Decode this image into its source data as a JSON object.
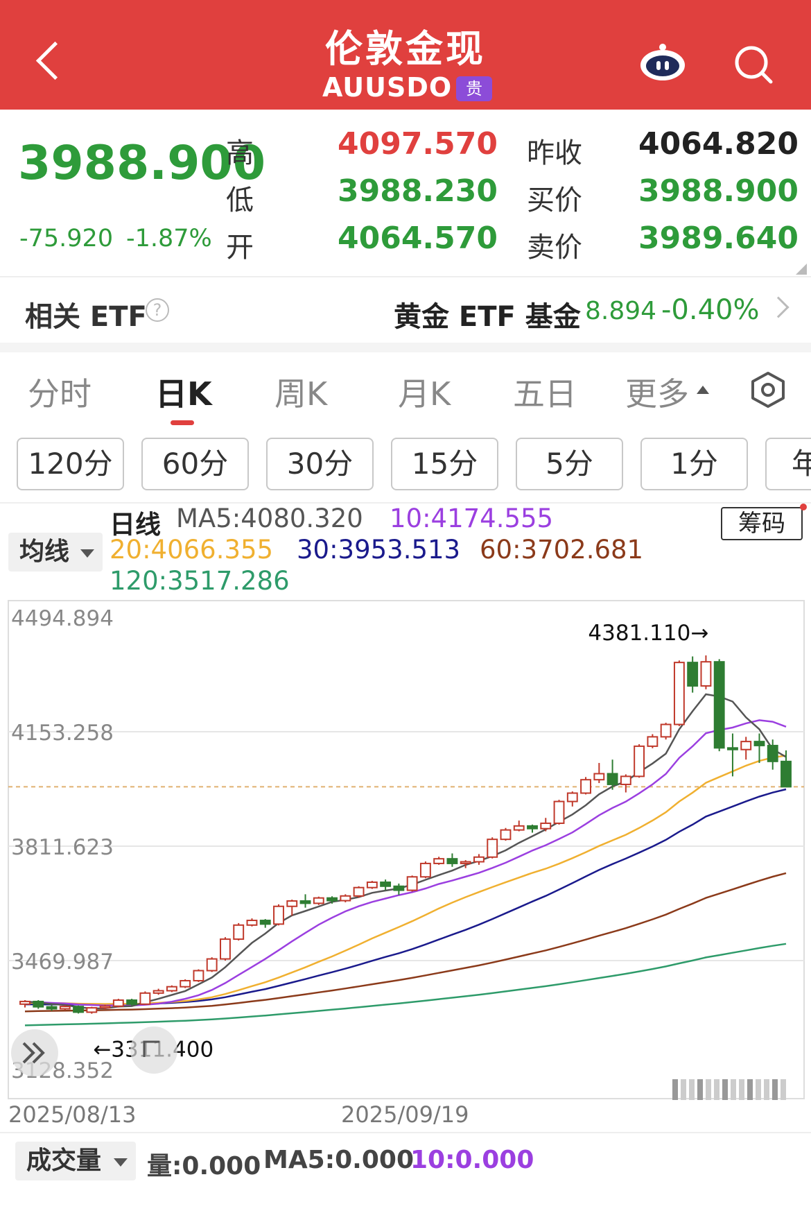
{
  "header": {
    "title": "伦敦金现",
    "symbol": "AUUSDO",
    "badge": "贵",
    "bg_color": "#e0403e"
  },
  "quote": {
    "price": "3988.900",
    "change": "-75.920",
    "change_pct": "-1.87%",
    "high_label": "高",
    "high": "4097.570",
    "low_label": "低",
    "low": "3988.230",
    "open_label": "开",
    "open": "4064.570",
    "prev_close_label": "昨收",
    "prev_close": "4064.820",
    "bid_label": "买价",
    "bid": "3988.900",
    "ask_label": "卖价",
    "ask": "3989.640"
  },
  "etf": {
    "label": "相关 ETF",
    "help_icon": "?",
    "fund_name": "黄金 ETF 基金",
    "fund_price": "8.894",
    "fund_pct": "-0.40%"
  },
  "tabs": [
    {
      "label": "分时",
      "active": false
    },
    {
      "label": "日K",
      "active": true
    },
    {
      "label": "周K",
      "active": false
    },
    {
      "label": "月K",
      "active": false
    },
    {
      "label": "五日",
      "active": false
    },
    {
      "label": "更多",
      "active": false
    }
  ],
  "intervals": [
    "120分",
    "60分",
    "30分",
    "15分",
    "5分",
    "1分",
    "年"
  ],
  "ma_legend": {
    "dropdown": "均线",
    "series_label": "日线",
    "ma5": "MA5:4080.320",
    "ma10": "10:4174.555",
    "ma20": "20:4066.355",
    "ma30": "30:3953.513",
    "ma60": "60:3702.681",
    "ma120": "120:3517.286",
    "chouma": "筹码"
  },
  "chart_data": {
    "type": "candlestick",
    "y_ticks": [
      "4494.894",
      "4153.258",
      "3811.623",
      "3469.987",
      "3128.352"
    ],
    "ylim": [
      3128.352,
      4494.894
    ],
    "max_annotation": "4381.110→",
    "min_annotation": "←3311.400",
    "x_labels": [
      "2025/08/13",
      "2025/09/19"
    ],
    "current_price": 3988.9,
    "colors": {
      "up": "#c0392b",
      "down": "#2e7d32",
      "ma5": "#555555",
      "ma10": "#9b3fe0",
      "ma20": "#f0b030",
      "ma30": "#1a1a8c",
      "ma60": "#8b3a1a",
      "ma120": "#2e9b6a"
    },
    "candles": [
      [
        3340,
        3348,
        3330,
        3352
      ],
      [
        3348,
        3332,
        3326,
        3352
      ],
      [
        3332,
        3326,
        3320,
        3338
      ],
      [
        3326,
        3333,
        3322,
        3337
      ],
      [
        3333,
        3316,
        3312,
        3336
      ],
      [
        3316,
        3329,
        3311.4,
        3332
      ],
      [
        3329,
        3334,
        3325,
        3338
      ],
      [
        3334,
        3352,
        3330,
        3356
      ],
      [
        3352,
        3340,
        3336,
        3356
      ],
      [
        3340,
        3373,
        3338,
        3378
      ],
      [
        3373,
        3380,
        3368,
        3386
      ],
      [
        3380,
        3392,
        3376,
        3396
      ],
      [
        3392,
        3410,
        3388,
        3414
      ],
      [
        3410,
        3440,
        3406,
        3444
      ],
      [
        3440,
        3475,
        3436,
        3480
      ],
      [
        3475,
        3534,
        3470,
        3540
      ],
      [
        3534,
        3576,
        3530,
        3582
      ],
      [
        3576,
        3590,
        3572,
        3596
      ],
      [
        3590,
        3579,
        3568,
        3594
      ],
      [
        3579,
        3632,
        3575,
        3638
      ],
      [
        3632,
        3648,
        3604,
        3652
      ],
      [
        3648,
        3641,
        3628,
        3668
      ],
      [
        3641,
        3657,
        3636,
        3661
      ],
      [
        3657,
        3649,
        3640,
        3662
      ],
      [
        3649,
        3663,
        3644,
        3668
      ],
      [
        3663,
        3688,
        3658,
        3692
      ],
      [
        3688,
        3704,
        3684,
        3708
      ],
      [
        3704,
        3692,
        3680,
        3712
      ],
      [
        3692,
        3680,
        3666,
        3700
      ],
      [
        3680,
        3720,
        3676,
        3724
      ],
      [
        3720,
        3760,
        3716,
        3766
      ],
      [
        3760,
        3774,
        3756,
        3780
      ],
      [
        3774,
        3760,
        3750,
        3790
      ],
      [
        3760,
        3765,
        3746,
        3770
      ],
      [
        3765,
        3779,
        3756,
        3788
      ],
      [
        3779,
        3832,
        3775,
        3838
      ],
      [
        3832,
        3860,
        3828,
        3866
      ],
      [
        3860,
        3872,
        3856,
        3888
      ],
      [
        3872,
        3864,
        3852,
        3876
      ],
      [
        3864,
        3880,
        3856,
        3896
      ],
      [
        3880,
        3945,
        3876,
        3950
      ],
      [
        3945,
        3970,
        3930,
        3975
      ],
      [
        3970,
        4010,
        3966,
        4018
      ],
      [
        4010,
        4028,
        4000,
        4060
      ],
      [
        4028,
        3996,
        3980,
        4070
      ],
      [
        3996,
        4020,
        3972,
        4026
      ],
      [
        4020,
        4110,
        4016,
        4116
      ],
      [
        4110,
        4138,
        4104,
        4146
      ],
      [
        4138,
        4175,
        4130,
        4180
      ],
      [
        4175,
        4360,
        4170,
        4366
      ],
      [
        4360,
        4290,
        4270,
        4378
      ],
      [
        4290,
        4362,
        4280,
        4381.11
      ],
      [
        4362,
        4105,
        4095,
        4370
      ],
      [
        4105,
        4100,
        4020,
        4148
      ],
      [
        4100,
        4124,
        4070,
        4138
      ],
      [
        4124,
        4112,
        4060,
        4148
      ],
      [
        4112,
        4064.57,
        4040,
        4130
      ],
      [
        4064.57,
        3988.9,
        3988.23,
        4097.57
      ]
    ]
  },
  "volume": {
    "dropdown": "成交量",
    "vol": "量:0.000",
    "ma5": "MA5:0.000",
    "ma10": "10:0.000"
  }
}
